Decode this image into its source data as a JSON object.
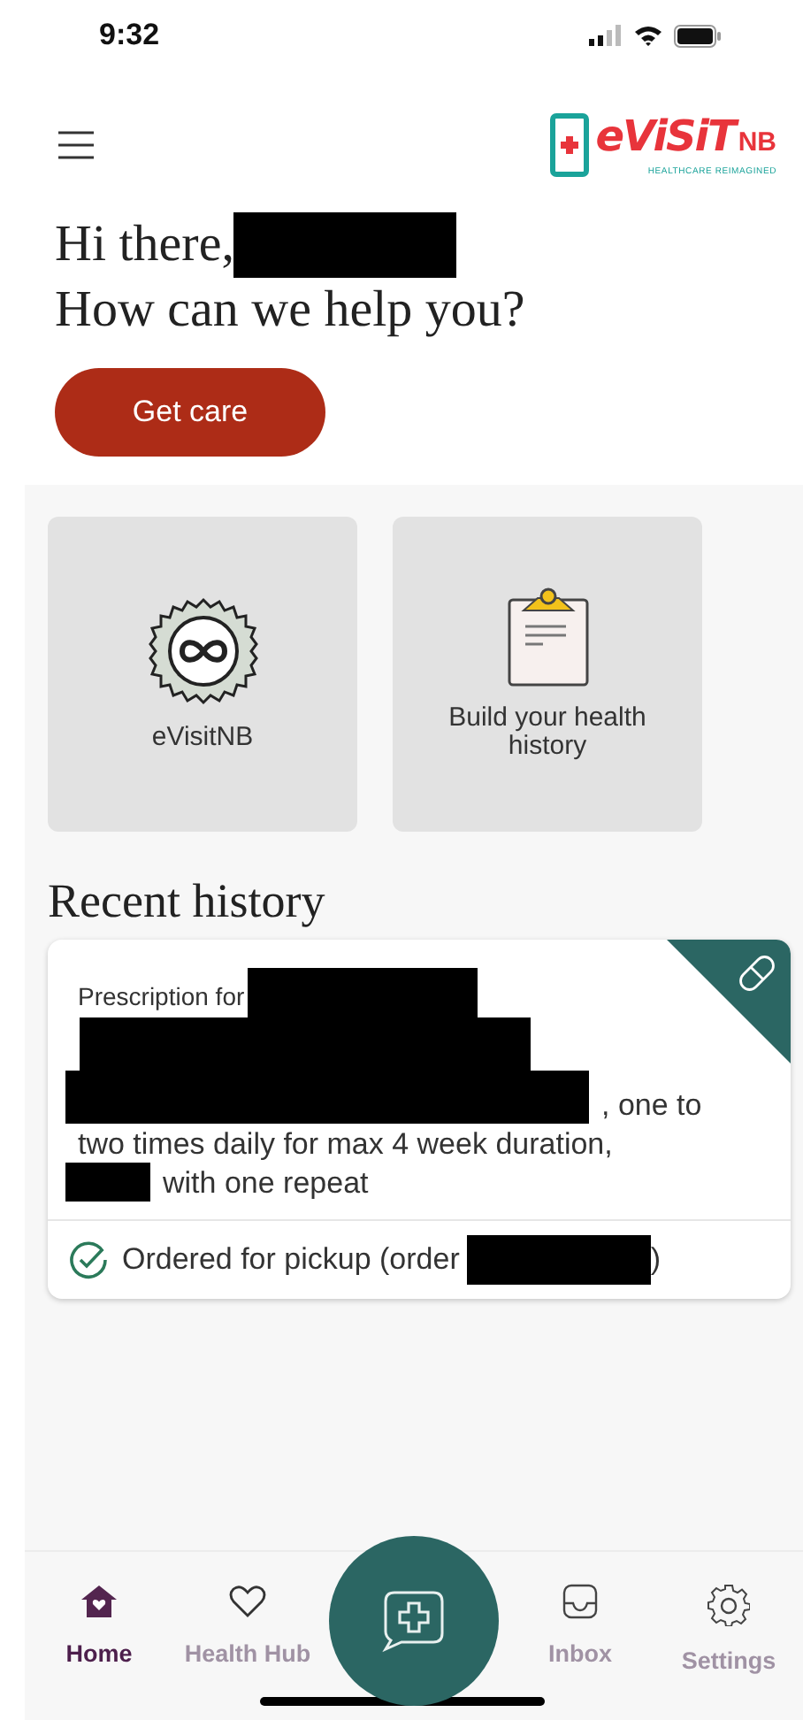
{
  "status_bar": {
    "time": "9:32"
  },
  "header": {
    "logo": {
      "word": "eViSiT",
      "suffix": "NB",
      "tagline": "HEALTHCARE REIMAGINED"
    }
  },
  "greeting": {
    "line_1": "Hi there,",
    "line_2": "How can we help you?"
  },
  "get_care_button": "Get care",
  "tiles": [
    {
      "kind": "badge",
      "label": "eVisitNB"
    },
    {
      "kind": "clipboard",
      "label": "Build your health history"
    }
  ],
  "recent_history": {
    "title": "Recent history",
    "card": {
      "heading": "Prescription for",
      "line_3_end": ", one to",
      "line_4": "two times daily for max 4 week duration,",
      "line_5_end": "with one repeat",
      "status": "Ordered for pickup (order",
      "status_end": ")"
    }
  },
  "tab_bar": [
    {
      "kind": "home",
      "label": "Home",
      "selected": true
    },
    {
      "kind": "heart",
      "label": "Health Hub",
      "selected": false
    },
    {
      "kind": "fab"
    },
    {
      "kind": "inbox",
      "label": "Inbox",
      "selected": false
    },
    {
      "kind": "gear",
      "label": "Settings",
      "selected": false
    }
  ]
}
